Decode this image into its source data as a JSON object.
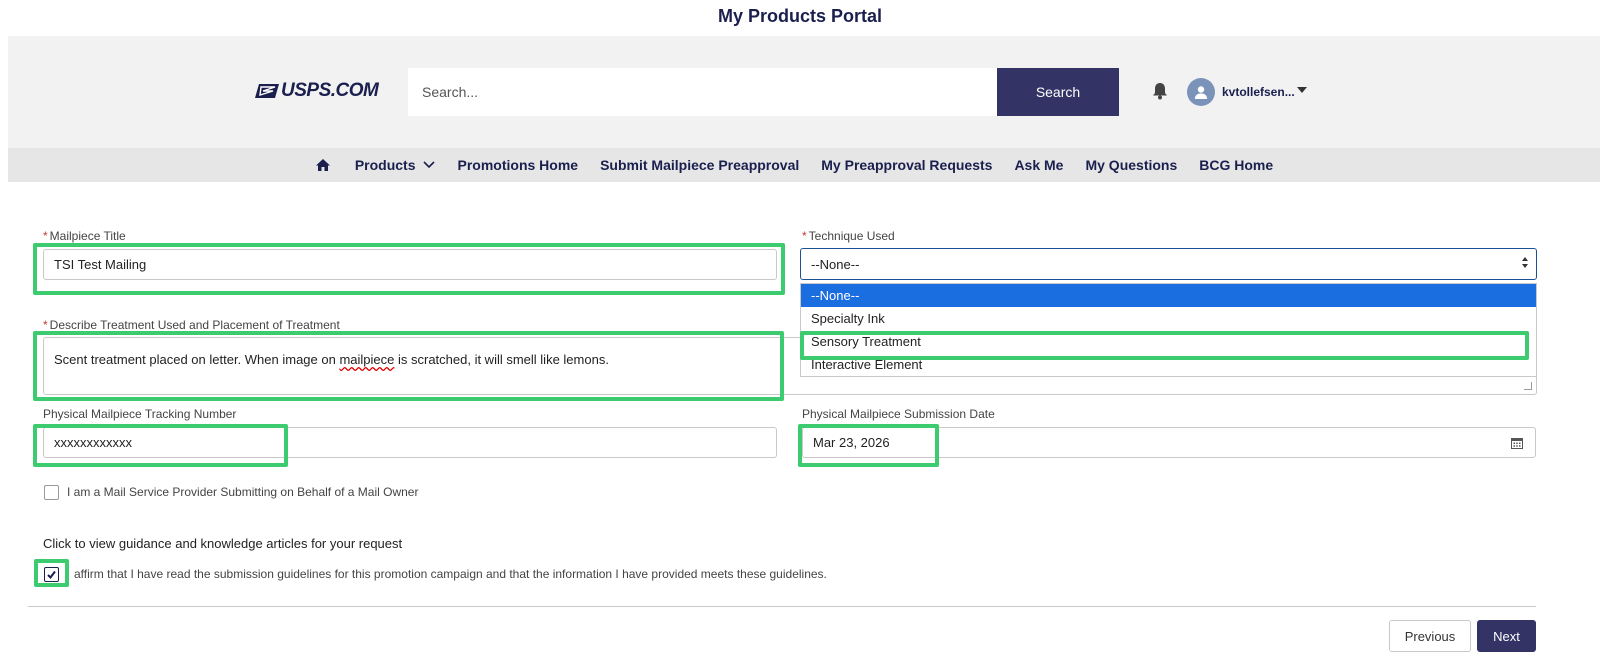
{
  "portal": {
    "title": "My Products Portal"
  },
  "header": {
    "logo_text": "USPS.COM",
    "search": {
      "placeholder": "Search...",
      "button_label": "Search"
    },
    "user": {
      "name": "kvtollefsen..."
    }
  },
  "nav": {
    "items": [
      {
        "label": "Products"
      },
      {
        "label": "Promotions Home"
      },
      {
        "label": "Submit Mailpiece Preapproval"
      },
      {
        "label": "My Preapproval Requests"
      },
      {
        "label": "Ask Me"
      },
      {
        "label": "My Questions"
      },
      {
        "label": "BCG Home"
      }
    ]
  },
  "form": {
    "required_mark": "*",
    "mailpiece_title": {
      "label": "Mailpiece Title",
      "value": "TSI Test Mailing"
    },
    "technique": {
      "label": "Technique Used",
      "value": "--None--",
      "options": [
        "--None--",
        "Specialty Ink",
        "Sensory Treatment",
        "Interactive Element"
      ]
    },
    "treatment": {
      "label": "Describe Treatment Used and Placement of Treatment",
      "value_before": "Scent treatment placed on letter. When image on ",
      "value_misspelled": "mailpiece",
      "value_after": " is scratched, it will smell like lemons."
    },
    "tracking": {
      "label": "Physical Mailpiece Tracking Number",
      "value": "xxxxxxxxxxxx"
    },
    "submission_date": {
      "label": "Physical Mailpiece Submission Date",
      "value": "Mar 23, 2026"
    },
    "msp_checkbox": {
      "label": "I am a Mail Service Provider Submitting on Behalf of a Mail Owner",
      "checked": false
    },
    "guidance_text": "Click to view guidance and knowledge articles for your request",
    "affirm_checkbox": {
      "label": "affirm that I have read the submission guidelines for this promotion campaign and that the information I have provided meets these guidelines.",
      "checked": true
    }
  },
  "footer": {
    "previous_label": "Previous",
    "next_label": "Next"
  },
  "colors": {
    "navy": "#333366",
    "highlight": "#3ccb6e",
    "selected_option": "#1a6ee0"
  }
}
